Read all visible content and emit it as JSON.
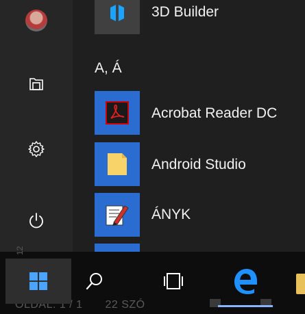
{
  "rail": {
    "items": [
      {
        "name": "user-avatar"
      },
      {
        "name": "documents-icon"
      },
      {
        "name": "settings-icon"
      },
      {
        "name": "power-icon"
      }
    ]
  },
  "apps": {
    "partial_top": "3D Builder",
    "section_letter": "A, Á",
    "items": [
      {
        "label": "Acrobat Reader DC",
        "tile_color": "#2b6cd1"
      },
      {
        "label": "Android Studio",
        "tile_color": "#2b6cd1"
      },
      {
        "label": "ÁNYK",
        "tile_color": "#2b6cd1"
      }
    ]
  },
  "taskbar": {
    "buttons": [
      "windows-start",
      "search",
      "task-view",
      "microsoft-edge",
      "file-explorer"
    ]
  },
  "ghost_statusbar": {
    "page": "OLDAL: 1 / 1",
    "words": "22 SZÓ",
    "number": "12"
  },
  "colors": {
    "accent": "#2b6cd1",
    "edge_blue": "#1e90ff",
    "taskbar": "#0d0d0d"
  }
}
